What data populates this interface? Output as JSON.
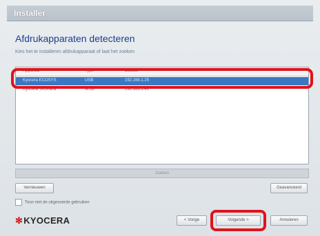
{
  "window": {
    "title": "Installer"
  },
  "page": {
    "heading": "Afdrukapparaten detecteren",
    "subheading": "Kies het te installeren afdrukapparaat of laat het zoeken"
  },
  "list": {
    "columns": [
      "Apparaat",
      "Type",
      "Locatie"
    ],
    "rows": [
      {
        "name": "Kyocera ECOSYS",
        "type": "USB",
        "location": "192.168.1.25",
        "selected": true
      },
      {
        "name": "Kyocera TASKalfa",
        "type": "WSD",
        "location": "192.168.1.40",
        "selected": false
      }
    ]
  },
  "status_text": "Zoeken",
  "buttons": {
    "refresh": "Vernieuwen",
    "advanced": "Geavanceerd",
    "back": "< Vorige",
    "next": "Volgende >",
    "cancel": "Annuleren"
  },
  "checkbox": {
    "label": "Toon niet de uitgevoerde gebruiken"
  },
  "brand": {
    "name": "KYOCERA",
    "color": "#d11a1a"
  },
  "colors": {
    "highlight": "#e1121c",
    "selection": "#3b78c2",
    "heading": "#1a3d8a"
  }
}
